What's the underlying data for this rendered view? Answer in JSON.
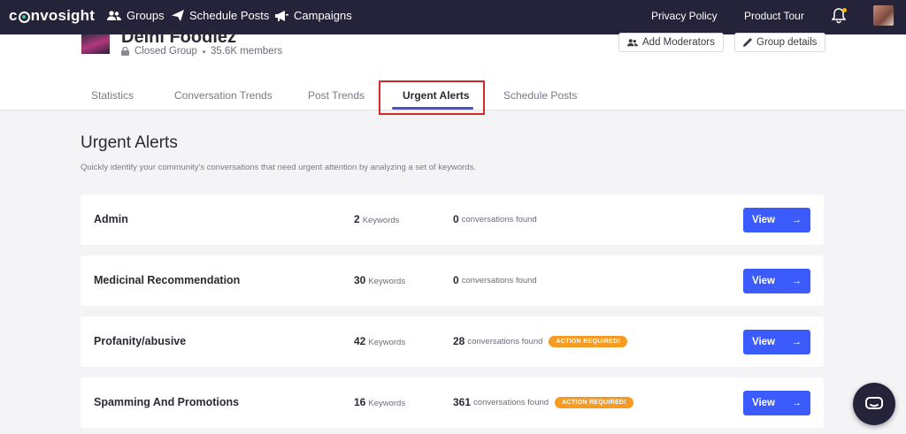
{
  "nav": {
    "logo": "convosight",
    "links": [
      {
        "label": "Groups",
        "icon": "users-icon"
      },
      {
        "label": "Schedule Posts",
        "icon": "send-icon"
      },
      {
        "label": "Campaigns",
        "icon": "megaphone-icon"
      }
    ],
    "right": {
      "privacy": "Privacy Policy",
      "tour": "Product Tour"
    }
  },
  "group": {
    "name": "Delhi Foodiez",
    "privacy": "Closed Group",
    "members": "35.6K members",
    "add_moderators": "Add Moderators",
    "group_details": "Group details"
  },
  "tabs": [
    {
      "label": "Statistics",
      "active": false
    },
    {
      "label": "Conversation Trends",
      "active": false
    },
    {
      "label": "Post Trends",
      "active": false
    },
    {
      "label": "Urgent Alerts",
      "active": true
    },
    {
      "label": "Schedule Posts",
      "active": false
    }
  ],
  "main": {
    "title": "Urgent Alerts",
    "description": "Quickly identify your community's conversations that need urgent attention by analyzing a set of keywords."
  },
  "alerts": [
    {
      "name": "Admin",
      "keywords": "2",
      "conversations": "0",
      "action_required": false
    },
    {
      "name": "Medicinal Recommendation",
      "keywords": "30",
      "conversations": "0",
      "action_required": false
    },
    {
      "name": "Profanity/abusive",
      "keywords": "42",
      "conversations": "28",
      "action_required": true
    },
    {
      "name": "Spamming And Promotions",
      "keywords": "16",
      "conversations": "361",
      "action_required": true
    }
  ],
  "labels": {
    "keywords_unit": "Keywords",
    "conversations_unit": "conversations found",
    "action_badge": "ACTION REQUIRED!",
    "view": "View"
  },
  "colors": {
    "topnav": "#25233a",
    "accent": "#3b5bfd",
    "badge": "#f59a23",
    "highlight": "#d62828"
  }
}
